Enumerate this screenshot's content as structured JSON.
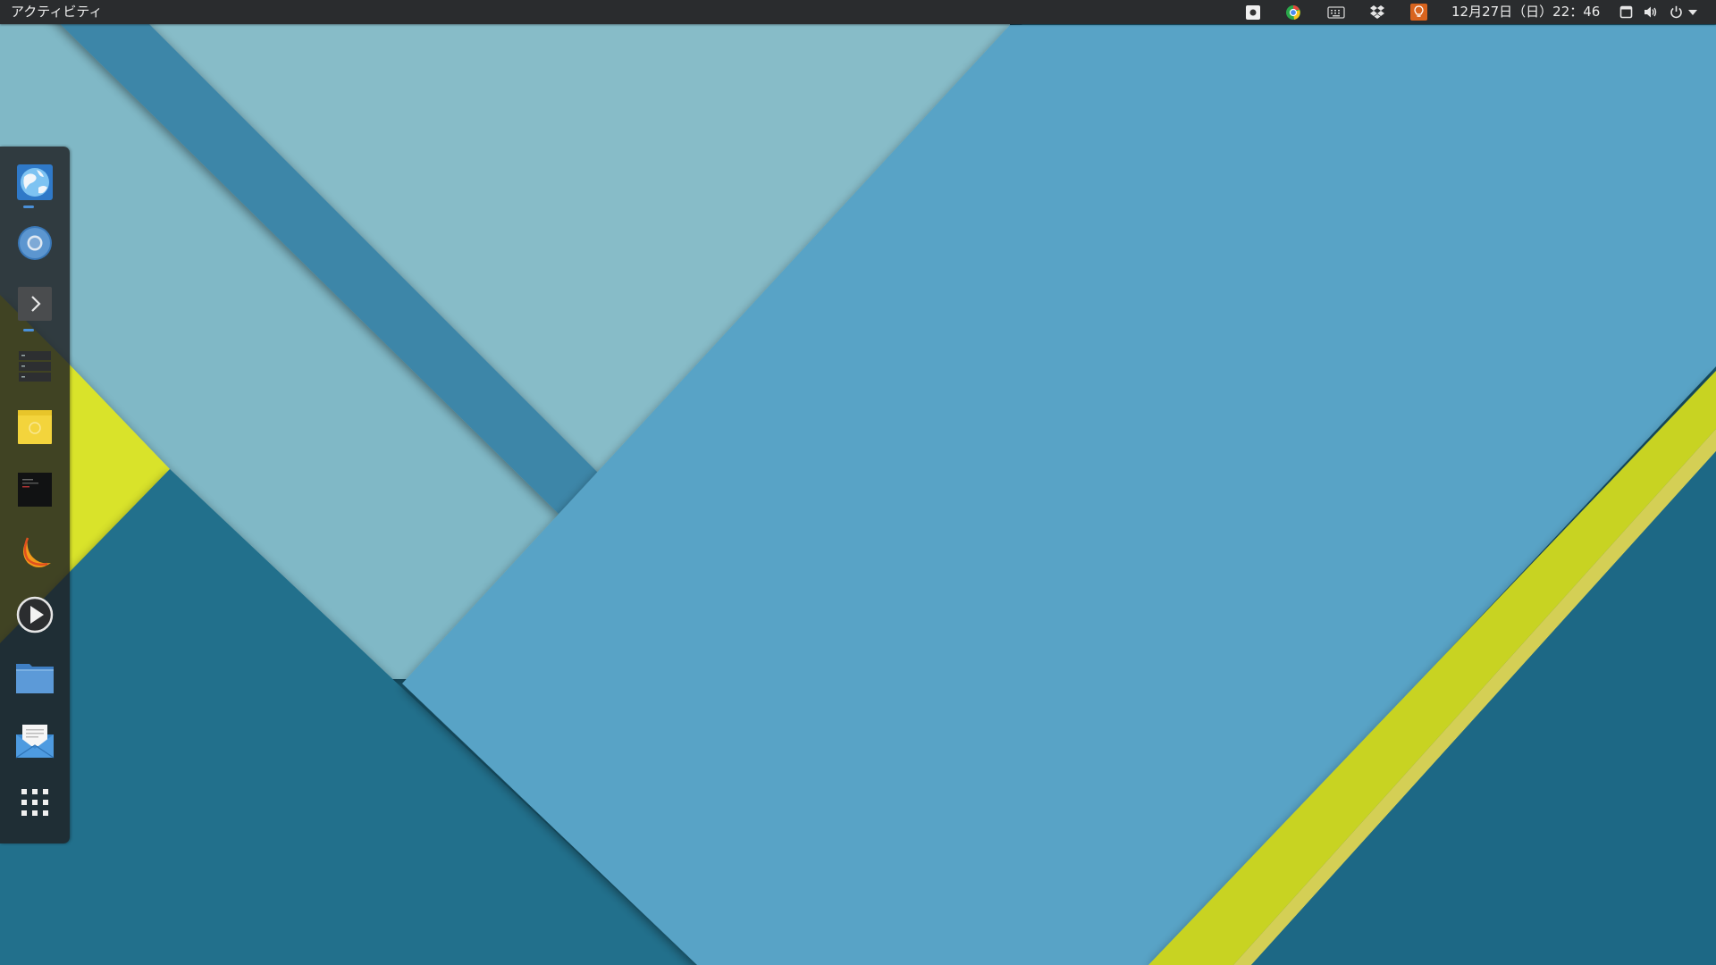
{
  "topbar": {
    "activities_label": "アクティビティ",
    "clock_text": "12月27日（日）22：46",
    "tray_icons": [
      "screenshot-icon",
      "chrome-icon",
      "keyboard-icon",
      "dropbox-icon",
      "ideas-icon"
    ],
    "system_icons": [
      "window-icon",
      "volume-icon",
      "power-icon",
      "chevron-down-icon"
    ]
  },
  "dock": {
    "items": [
      {
        "name": "web-browser",
        "icon": "globe-icon",
        "running": true
      },
      {
        "name": "chromium",
        "icon": "chromium-icon",
        "running": false
      },
      {
        "name": "terminal",
        "icon": "terminal-icon",
        "running": true
      },
      {
        "name": "server-manager",
        "icon": "server-icon",
        "running": false
      },
      {
        "name": "sticky-notes",
        "icon": "sticky-note-icon",
        "running": false
      },
      {
        "name": "text-console",
        "icon": "console-icon",
        "running": false
      },
      {
        "name": "mango",
        "icon": "mango-icon",
        "running": false
      },
      {
        "name": "media-player",
        "icon": "play-icon",
        "running": false
      },
      {
        "name": "file-manager",
        "icon": "folder-icon",
        "running": false
      },
      {
        "name": "mail-client",
        "icon": "mail-icon",
        "running": false
      },
      {
        "name": "show-applications",
        "icon": "app-grid-icon",
        "running": false
      }
    ]
  },
  "colors": {
    "topbar_bg": "#2a2c2e",
    "wall_pale_teal": "#80b8c6",
    "wall_mid_blue": "#5aa4c6",
    "wall_stripe_blue": "#3d86a8",
    "wall_dark_teal": "#1e6a86",
    "wall_yellow": "#c4cf1e",
    "accent_blue": "#4a90d9"
  }
}
